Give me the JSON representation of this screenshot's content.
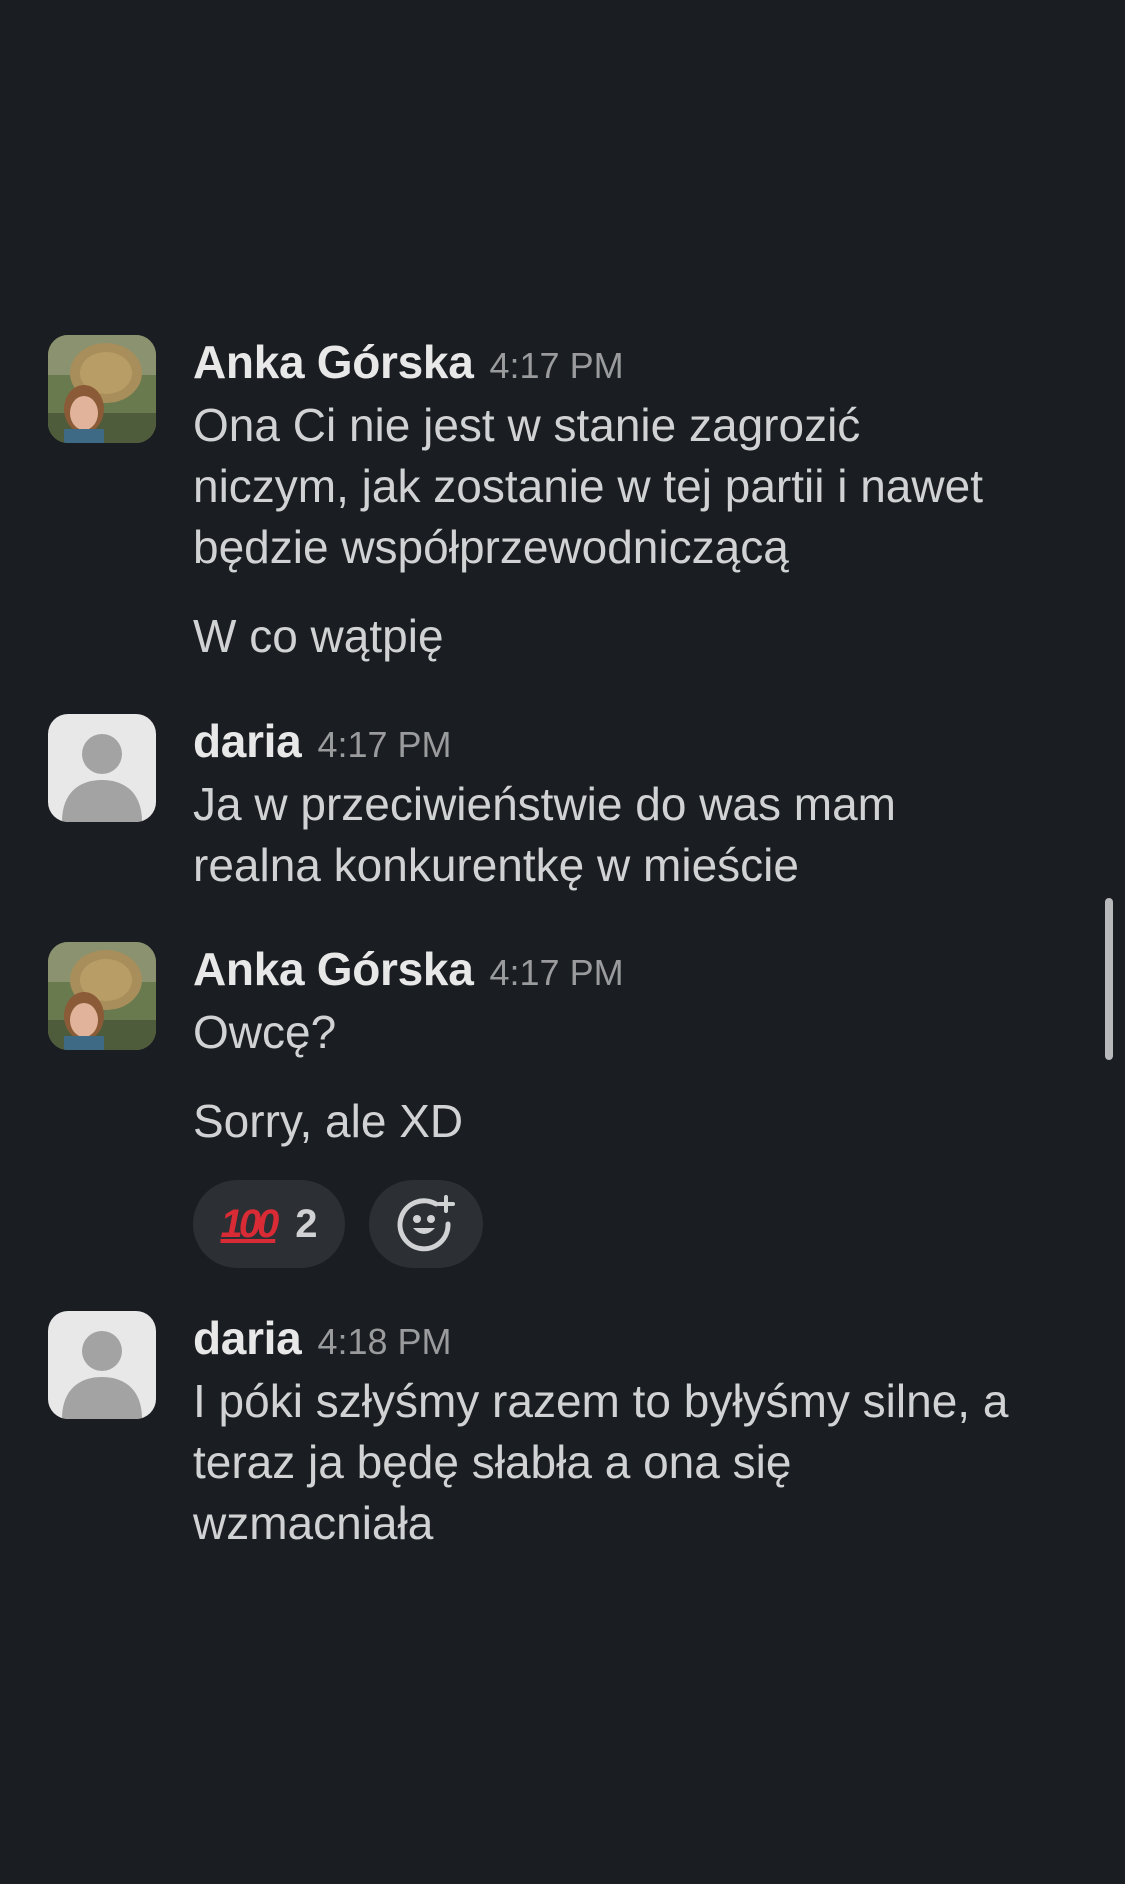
{
  "messages": [
    {
      "author": "Anka Górska",
      "time": "4:17 PM",
      "avatar": "photo",
      "paragraphs": [
        [
          "Ona Ci nie jest w stanie zagrozić",
          "niczym, jak zostanie w tej partii i nawet",
          "będzie współprzewodniczącą"
        ],
        [
          "W co wątpię"
        ]
      ]
    },
    {
      "author": "daria",
      "time": "4:17 PM",
      "avatar": "default-person-icon",
      "paragraphs": [
        [
          "Ja w przeciwieństwie do was mam",
          "realna konkurentkę w mieście"
        ]
      ]
    },
    {
      "author": "Anka Górska",
      "time": "4:17 PM",
      "avatar": "photo",
      "paragraphs": [
        [
          "Owcę?"
        ],
        [
          "Sorry, ale XD"
        ]
      ],
      "reactions": [
        {
          "emoji": "hundred-points-emoji",
          "glyph": "100",
          "count": "2"
        }
      ],
      "add_reaction_icon": "add-emoji-icon"
    },
    {
      "author": "daria",
      "time": "4:18 PM",
      "avatar": "default-person-icon",
      "paragraphs": [
        [
          "I póki szłyśmy razem to byłyśmy silne, a",
          "teraz ja będę słabła a ona się",
          "wzmacniała"
        ]
      ]
    }
  ],
  "colors": {
    "background": "#1a1d21",
    "text": "#d1d2d3",
    "name": "#e8e8e8",
    "timestamp": "#9a9b9d",
    "pill": "#2c2f33",
    "hundred_red": "#d92b35"
  }
}
